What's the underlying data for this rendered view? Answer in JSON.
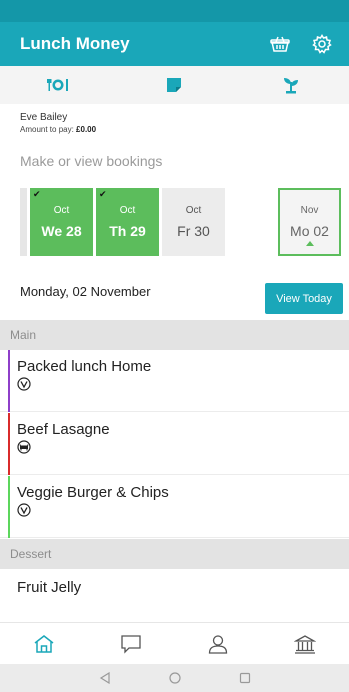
{
  "app": {
    "title": "Lunch Money",
    "accent": "#1aa7b9",
    "booked_color": "#5cbd5c"
  },
  "header_icons": [
    "basket-icon",
    "gear-icon"
  ],
  "top_tabs": [
    {
      "icon": "meal-icon"
    },
    {
      "icon": "note-icon"
    },
    {
      "icon": "plant-icon"
    }
  ],
  "user": {
    "name": "Eve Bailey",
    "amount_label": "Amount to pay:",
    "amount_value": "£0.00"
  },
  "bookings_label": "Make or view bookings",
  "days": [
    {
      "month": "Oct",
      "day": "We 28",
      "booked": true
    },
    {
      "month": "Oct",
      "day": "Th 29",
      "booked": true
    },
    {
      "month": "Oct",
      "day": "Fr 30",
      "booked": false
    },
    {
      "month": "Nov",
      "day": "Mo 02",
      "booked": false,
      "selected": true
    }
  ],
  "selected_date": "Monday, 02 November",
  "view_today_label": "View Today",
  "sections": {
    "main": {
      "title": "Main",
      "items": [
        {
          "name": "Packed lunch Home",
          "diet_icon": "vegetarian-icon",
          "color": "#8e3fc9"
        },
        {
          "name": "Beef Lasagne",
          "diet_icon": "beef-icon",
          "color": "#d92b2b"
        },
        {
          "name": "Veggie Burger & Chips",
          "diet_icon": "vegetarian-icon",
          "color": "#5cd65c"
        }
      ]
    },
    "dessert": {
      "title": "Dessert",
      "items": [
        {
          "name": "Fruit Jelly"
        }
      ]
    }
  },
  "bottom_nav": [
    "home-icon",
    "chat-icon",
    "profile-icon",
    "bank-icon"
  ]
}
